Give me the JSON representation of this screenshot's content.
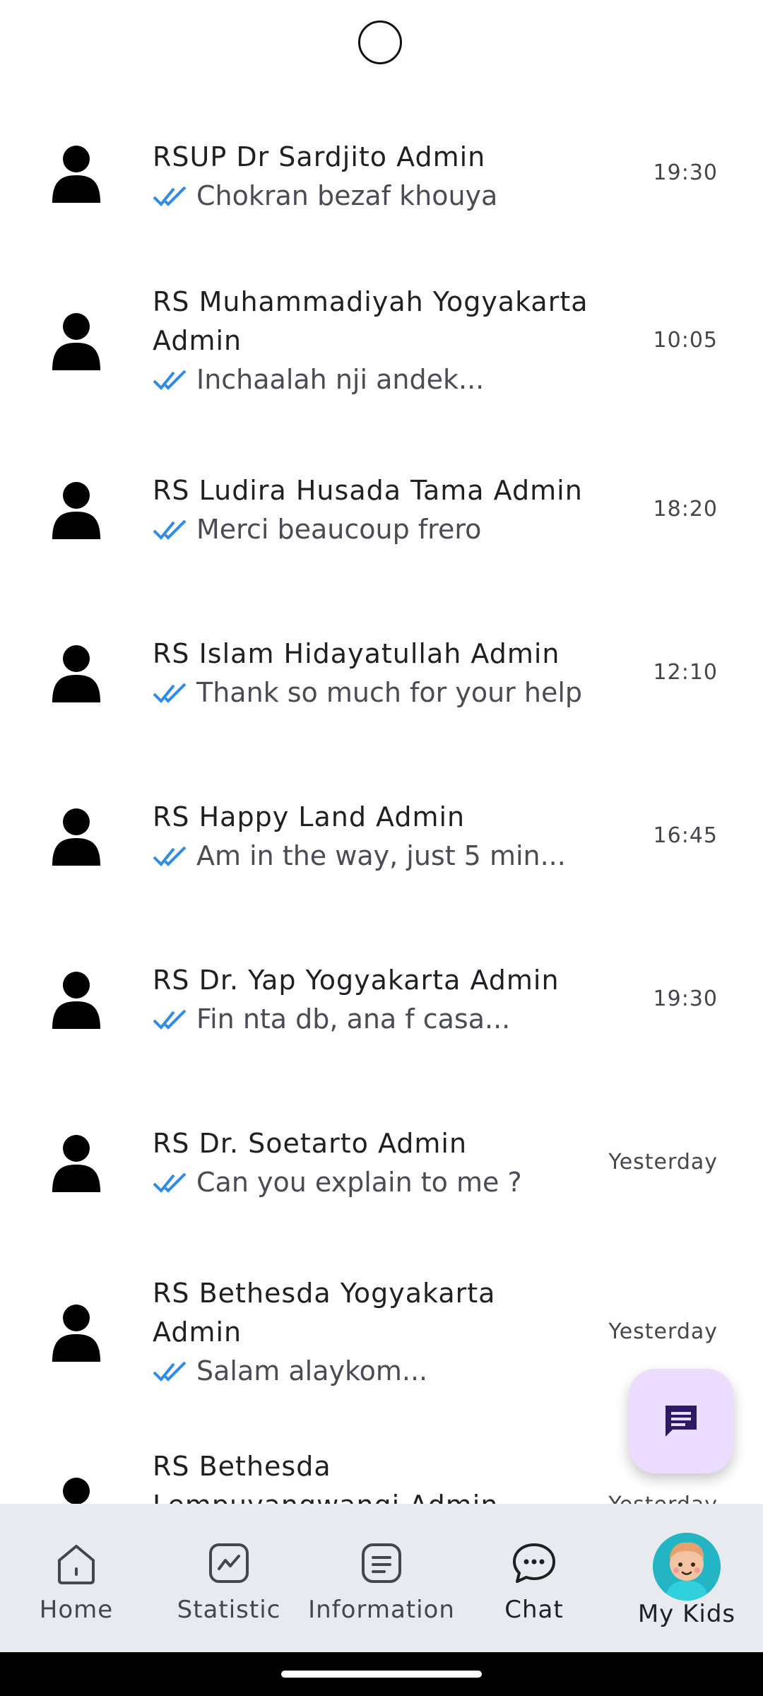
{
  "chats": [
    {
      "name": "RSUP Dr Sardjito Admin",
      "message": "Chokran bezaf khouya",
      "time": "19:30"
    },
    {
      "name": "RS Muhammadiyah Yogyakarta Admin",
      "message": "Inchaalah nji andek...",
      "time": "10:05"
    },
    {
      "name": "RS Ludira Husada Tama Admin",
      "message": "Merci beaucoup frero",
      "time": "18:20"
    },
    {
      "name": "RS Islam Hidayatullah Admin",
      "message": "Thank so much for your help",
      "time": "12:10"
    },
    {
      "name": "RS Happy Land Admin",
      "message": "Am in the way, just 5 min...",
      "time": "16:45"
    },
    {
      "name": "RS Dr. Yap Yogyakarta Admin",
      "message": "Fin nta db, ana f casa...",
      "time": "19:30"
    },
    {
      "name": "RS Dr. Soetarto Admin",
      "message": "Can you explain to me ?",
      "time": "Yesterday"
    },
    {
      "name": "RS Bethesda Yogyakarta Admin",
      "message": "Salam alaykom...",
      "time": "Yesterday"
    },
    {
      "name": "RS Bethesda Lempuyangwangi Admin",
      "message": "",
      "time": "Yesterday"
    }
  ],
  "nav": {
    "home": "Home",
    "statistic": "Statistic",
    "information": "Information",
    "chat": "Chat",
    "my_kids": "My Kids"
  },
  "colors": {
    "read_ticks": "#2f8be6",
    "fab_background": "#ecdcff",
    "fab_icon": "#2b1a66",
    "navbar_background": "#e7ebf0"
  },
  "icons": {
    "fab": "new-chat-icon",
    "home": "home-icon",
    "statistic": "statistic-icon",
    "information": "information-icon",
    "chat": "chat-icon",
    "my_kids": "kid-avatar"
  }
}
